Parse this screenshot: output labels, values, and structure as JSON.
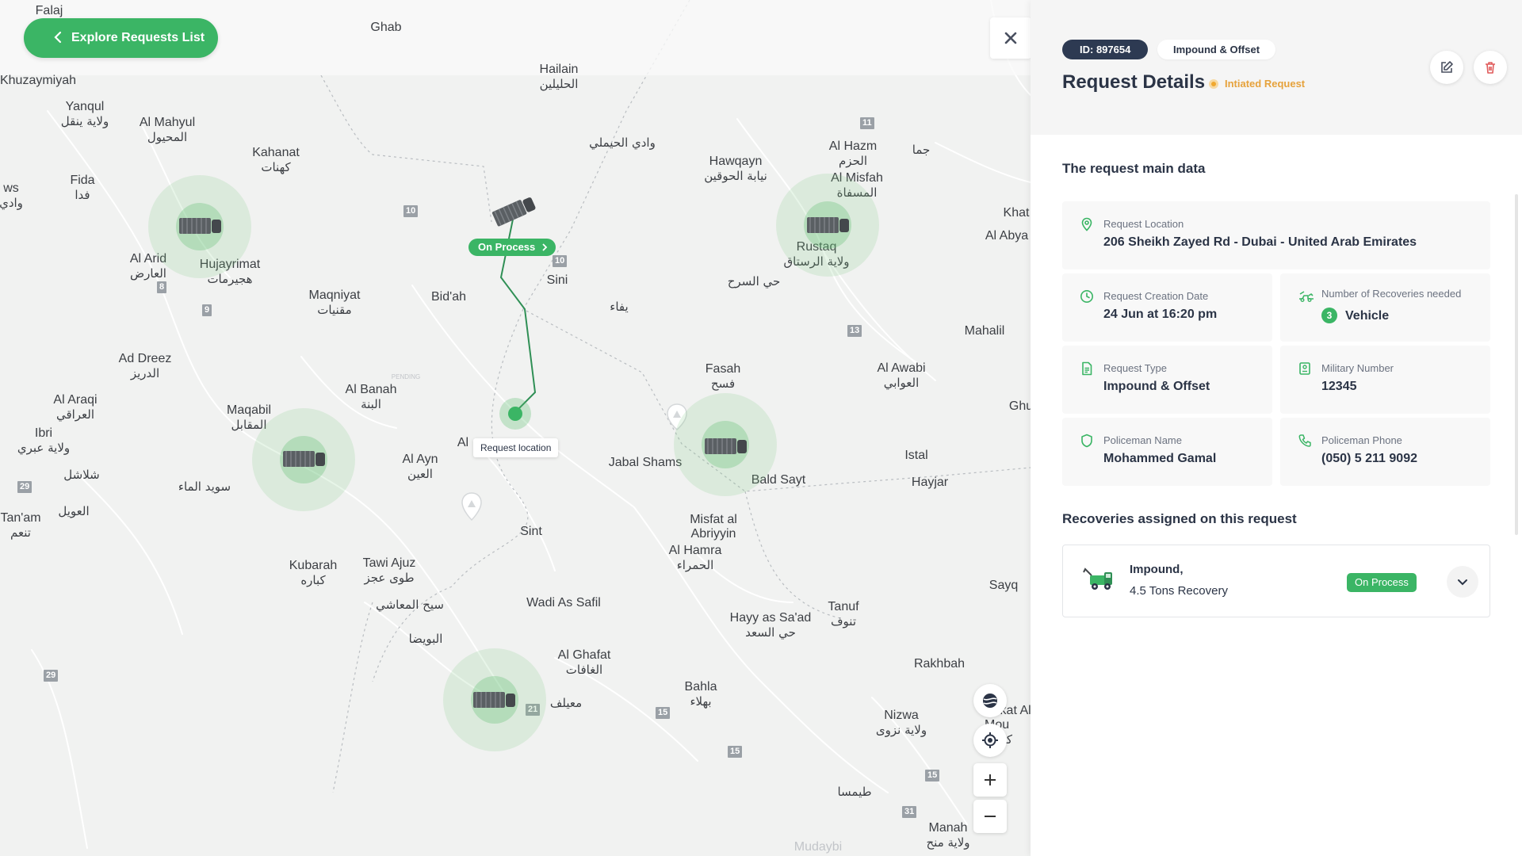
{
  "map": {
    "places": [
      {
        "en": "Falaj",
        "ar": "",
        "faded": true
      },
      {
        "en": "Ghab",
        "ar": "",
        "faded": true
      },
      {
        "en": "Hailain",
        "ar": "الحليلين"
      },
      {
        "en": "Khuzaymiyah",
        "ar": ""
      },
      {
        "en": "Yanqul",
        "ar": "ولاية ينقل"
      },
      {
        "en": "Al Mahyul",
        "ar": "المحيول"
      },
      {
        "en": "Kahanat",
        "ar": "كهنات"
      },
      {
        "en": "Fida",
        "ar": "فدا"
      },
      {
        "en": "ws",
        "ar": "وادي"
      },
      {
        "en": "",
        "ar": "وادي الحيملي"
      },
      {
        "en": "Hawqayn",
        "ar": "نيابة الحوقين"
      },
      {
        "en": "Al Hazm",
        "ar": "الحزم"
      },
      {
        "en": "Al Misfah",
        "ar": "المسفاة"
      },
      {
        "en": "",
        "ar": "جما"
      },
      {
        "en": "Khat",
        "ar": ""
      },
      {
        "en": "Al Abya",
        "ar": ""
      },
      {
        "en": "Al Arid",
        "ar": "العارض"
      },
      {
        "en": "Hujayrimat",
        "ar": "هجيرمات"
      },
      {
        "en": "Rustaq",
        "ar": "ولاية الرستاق"
      },
      {
        "en": "Sini",
        "ar": ""
      },
      {
        "en": "",
        "ar": "حي السرح"
      },
      {
        "en": "Maqniyat",
        "ar": "مقنيات"
      },
      {
        "en": "Bid'ah",
        "ar": ""
      },
      {
        "en": "",
        "ar": "يفاء"
      },
      {
        "en": "Mahalil",
        "ar": ""
      },
      {
        "en": "Ad Dreez",
        "ar": "الدريز"
      },
      {
        "en": "Fasah",
        "ar": "فسح"
      },
      {
        "en": "Al Awabi",
        "ar": "العوابي"
      },
      {
        "en": "Al Banah",
        "ar": "البنة"
      },
      {
        "en": "Al Araqi",
        "ar": "العراقي"
      },
      {
        "en": "Maqabil",
        "ar": "المقابل"
      },
      {
        "en": "Ibri",
        "ar": "ولاية عبري"
      },
      {
        "en": "Al",
        "ar": ""
      },
      {
        "en": "Jabal Shams",
        "ar": ""
      },
      {
        "en": "Ghu",
        "ar": ""
      },
      {
        "en": "Al Ayn",
        "ar": "العين"
      },
      {
        "en": "Istal",
        "ar": ""
      },
      {
        "en": "Bald Sayt",
        "ar": ""
      },
      {
        "en": "Hayjar",
        "ar": ""
      },
      {
        "en": "",
        "ar": "شلاشل"
      },
      {
        "en": "",
        "ar": "سويد الماء"
      },
      {
        "en": "Tan'am",
        "ar": "تنعم"
      },
      {
        "en": "",
        "ar": "العويل"
      },
      {
        "en": "Sint",
        "ar": ""
      },
      {
        "en": "Misfat al Abriyyin",
        "ar": ""
      },
      {
        "en": "Al Hamra",
        "ar": "الحمراء"
      },
      {
        "en": "Kubarah",
        "ar": "كباره"
      },
      {
        "en": "Tawi Ajuz",
        "ar": "طوى عجز"
      },
      {
        "en": "Sayq",
        "ar": ""
      },
      {
        "en": "",
        "ar": "سيح المعاشي"
      },
      {
        "en": "Wadi As Safil",
        "ar": ""
      },
      {
        "en": "Tanuf",
        "ar": "تنوف"
      },
      {
        "en": "Hayy as Sa'ad",
        "ar": "حي السعد"
      },
      {
        "en": "",
        "ar": "البويضا"
      },
      {
        "en": "Al Ghafat",
        "ar": "الغافات"
      },
      {
        "en": "Rakhbah",
        "ar": ""
      },
      {
        "en": "Bahla",
        "ar": "بهلاء"
      },
      {
        "en": "",
        "ar": "معيلف"
      },
      {
        "en": "Nizwa",
        "ar": "ولاية نزوى"
      },
      {
        "en": "Birkat Al Mou",
        "ar": "كة ال"
      },
      {
        "en": "",
        "ar": "طيمسا"
      },
      {
        "en": "Manah",
        "ar": "ولاية منح"
      },
      {
        "en": "Mudaybi",
        "ar": "",
        "faded": true
      },
      {
        "en": "PENDING",
        "ar": "",
        "faded": true
      }
    ],
    "shields": [
      "10",
      "10",
      "11",
      "8",
      "9",
      "13",
      "29",
      "29",
      "21",
      "15",
      "15",
      "15",
      "31"
    ],
    "explore_button": "Explore Requests List",
    "on_process_label": "On Process",
    "request_location_label": "Request location",
    "truck_color": "#5a5f63",
    "accent": "#3bb565"
  },
  "panel": {
    "id_badge": "ID: 897654",
    "type_badge": "Impound & Offset",
    "title": "Request Details",
    "status": "Intiated Request",
    "main_data_title": "The request main data",
    "fields": {
      "location": {
        "label": "Request Location",
        "value": "206 Sheikh Zayed Rd - Dubai - United Arab Emirates"
      },
      "creation_date": {
        "label": "Request Creation Date",
        "value": "24 Jun at 16:20 pm"
      },
      "recoveries_needed": {
        "label": "Number of Recoveries needed",
        "count": "3",
        "unit": "Vehicle"
      },
      "request_type": {
        "label": "Request Type",
        "value": "Impound & Offset"
      },
      "military_number": {
        "label": "Military Number",
        "value": "12345"
      },
      "policeman_name": {
        "label": "Policeman Name",
        "value": "Mohammed Gamal"
      },
      "policeman_phone": {
        "label": "Policeman Phone",
        "value": "(050) 5 211 9092"
      }
    },
    "recoveries_title": "Recoveries assigned on this request",
    "recovery": {
      "line1": "Impound,",
      "line2": "4.5 Tons Recovery",
      "status": "On Process"
    }
  }
}
